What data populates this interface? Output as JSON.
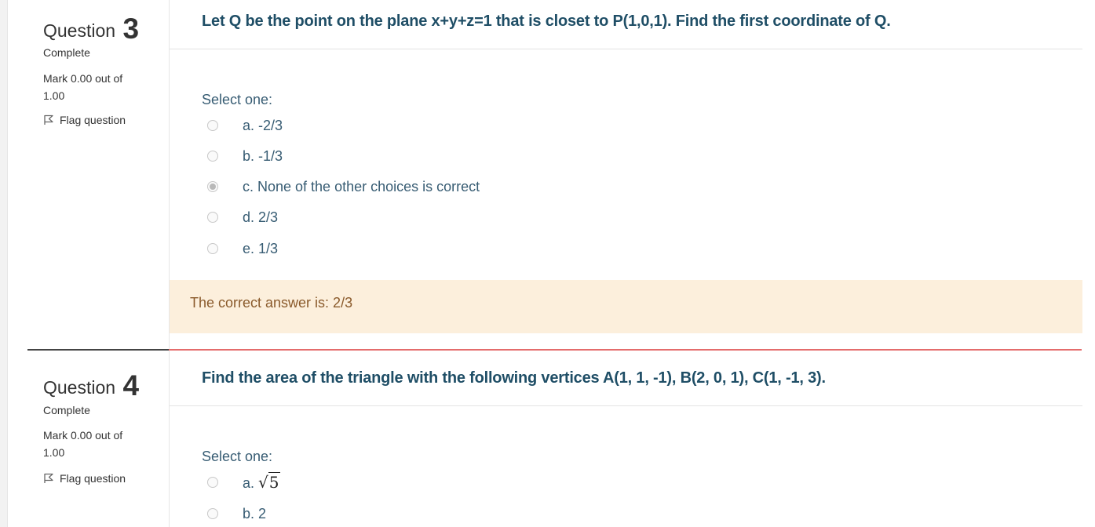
{
  "q3": {
    "label": "Question",
    "number": "3",
    "state": "Complete",
    "grade": "Mark 0.00 out of 1.00",
    "flag": "Flag question",
    "text": "Let Q be the point on the plane x+y+z=1 that is closet to P(1,0,1). Find the first coordinate of Q.",
    "select_one": "Select one:",
    "options": [
      {
        "label": "a. -2/3",
        "checked": false
      },
      {
        "label": "b. -1/3",
        "checked": false
      },
      {
        "label": "c. None of the other choices is correct",
        "checked": true
      },
      {
        "label": "d. 2/3",
        "checked": false
      },
      {
        "label": "e. 1/3",
        "checked": false
      }
    ],
    "feedback": "The correct answer is: 2/3"
  },
  "q4": {
    "label": "Question",
    "number": "4",
    "state": "Complete",
    "grade": "Mark 0.00 out of 1.00",
    "flag": "Flag question",
    "text": "Find the area of the triangle with the following vertices A(1, 1, -1), B(2, 0, 1), C(1, -1, 3).",
    "select_one": "Select one:",
    "options": [
      {
        "prefix": "a.",
        "sqrt_radicand": "5",
        "checked": false
      },
      {
        "label": "b. 2",
        "checked": false
      }
    ]
  },
  "colors": {
    "question_text": "#1f4e66",
    "answer_text": "#375c73",
    "feedback_bg": "#fcefdc",
    "incorrect_border": "#e46c6c"
  },
  "icons": {
    "flag": "flag-icon",
    "radio": "radio-button"
  }
}
